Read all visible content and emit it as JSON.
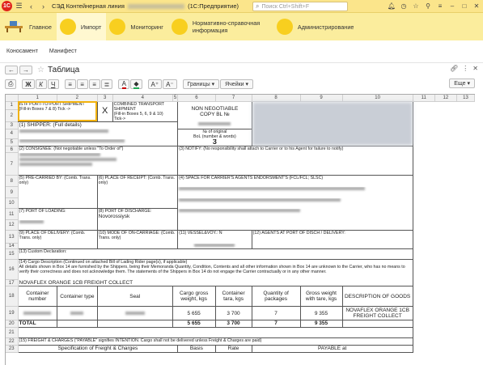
{
  "titlebar": {
    "title_prefix": "СЭД Контейнерная линия",
    "title_suffix": "(1С:Предприятие)",
    "search_placeholder": "Поиск Ctrl+Shift+F"
  },
  "sections": [
    {
      "label": "Главное"
    },
    {
      "label": "Импорт"
    },
    {
      "label": "Мониторинг"
    },
    {
      "label": "Нормативно-справочная информация"
    },
    {
      "label": "Администрирование"
    }
  ],
  "subnav": {
    "item1": "Коносамент",
    "item2": "Манифест"
  },
  "form": {
    "title": "Таблица"
  },
  "toolbar": {
    "bold": "Ж",
    "italic": "К",
    "underline": "Ч",
    "borders": "Границы",
    "cells": "Ячейки",
    "more": "Еще"
  },
  "sheet": {
    "cols": [
      "1",
      "2",
      "3",
      "4",
      "5",
      "6",
      "7",
      "8",
      "9",
      "10",
      "11",
      "12",
      "13"
    ],
    "rows": [
      "1",
      "2",
      "3",
      "4",
      "5",
      "6",
      "7",
      "8",
      "9",
      "10",
      "11",
      "12",
      "13",
      "14",
      "15",
      "16",
      "17",
      "18",
      "19",
      "20",
      "21",
      "22",
      "23"
    ],
    "t_if_port": "IS IF PORT-TO-PORT SHIPMENT",
    "t_fill1": "(Fill-in Boxes 7 & 8) Tick ->",
    "t_x": "X",
    "t_combined": "COMBINED TRANSPORT SHIPMENT",
    "t_fill2": "(Fill-in Boxes 5, 6, 9 & 10)",
    "t_tick": "Tick->",
    "t_nonneg": "NON NEGOTIABLE",
    "t_copybl": "COPY BL №",
    "t_nooriginal": "№ of original",
    "t_bol": "BoL (number & words)",
    "t_three": "3",
    "t_shipper": "(1) SHIPPER: (Full details)",
    "t_consignee": "(2) CONSIGNEE: (Not negotiable unless \"To Order of\")",
    "t_notify": "(3) NOTIFY: (No responsibility shall attach to Carrier or to his Agent for failure to notify)",
    "t_precarried": "(5) PRE-CARRIED BY: (Comb. Trans. only)",
    "t_placereceipt": "(6) PLACE OF RECEIPT: (Comb. Trans. only)",
    "t_space": "(4) SPACE FOR CARRIER'S AGENTS ENDORSMENT'S (FCL/FCL; SLSC)",
    "t_portload": "(7) PORT OF LOADING:",
    "t_portdis": "(8) PORT OF DISCHARGE:",
    "t_novoross": "Novorossiysk",
    "t_placedel": "(9) PLACE OF DELIVERY: (Comb. Trans. only)",
    "t_oncarriage": "(10) MODE OF ON-CARRIAGE: (Comb. Trans. only)",
    "t_vessel": "(11) VESSEL&VOY.: N",
    "t_agents": "(12) AGENTS AT PORT OF DISCH / DELIVERY:",
    "t_customs": "(13) Custom Declaration:",
    "t_cargo": "(14) Cargo Description (Continued on attached Bill of Lading Rider page(s), if applicable)",
    "t_cargo2": "All details shown in Box 14 are furnished by the Shippers, being their Memoranda Quantity, Condition, Contents and all other information shown in Box 14 are unknown to the Carrier, who has no means to verify their correctness and does not acknowledge them. The statements of the Shippers in Box 14 do not engage the Carrier contractually or in any other manner.",
    "t_freight": "NOVAFLEX ORANGE 1CB FREIGHT COLLECT",
    "h_container": "Container number",
    "h_ctype": "Container type",
    "h_seal": "Seal",
    "h_cargo": "Cargo gross weight, kgs",
    "h_tara": "Container tara, kgs",
    "h_qty": "Quantity of packages",
    "h_gross": "Gross weight with tare, kgs",
    "h_desc": "DESCRIPTION OF GOODS",
    "r_cargo": "5 655",
    "r_tara": "3 700",
    "r_qty": "7",
    "r_gross": "9 355",
    "r_desc": "NOVAFLEX ORANGE 1CB FREIGHT COLLECT",
    "t_total": "TOTAL",
    "t_total_cargo": "5 655",
    "t_total_tara": "3 700",
    "t_total_qty": "7",
    "t_total_gross": "9 355",
    "t_freightch": "(15) FREIGHT & CHARGES (\"PAYABLE\" signifies INTENTION. Cargo shall not be delivered unless Freight & Charges are paid)",
    "t_spec": "Specification of Freight & Charges",
    "t_basis": "Basis",
    "t_rate": "Rate",
    "t_payable": "PAYABLE at"
  },
  "colors": {
    "section_bar": "#fbed9d",
    "title_bar": "#fbe58b",
    "bubble": "#f8cf1f",
    "selection": "#f2b20c"
  }
}
